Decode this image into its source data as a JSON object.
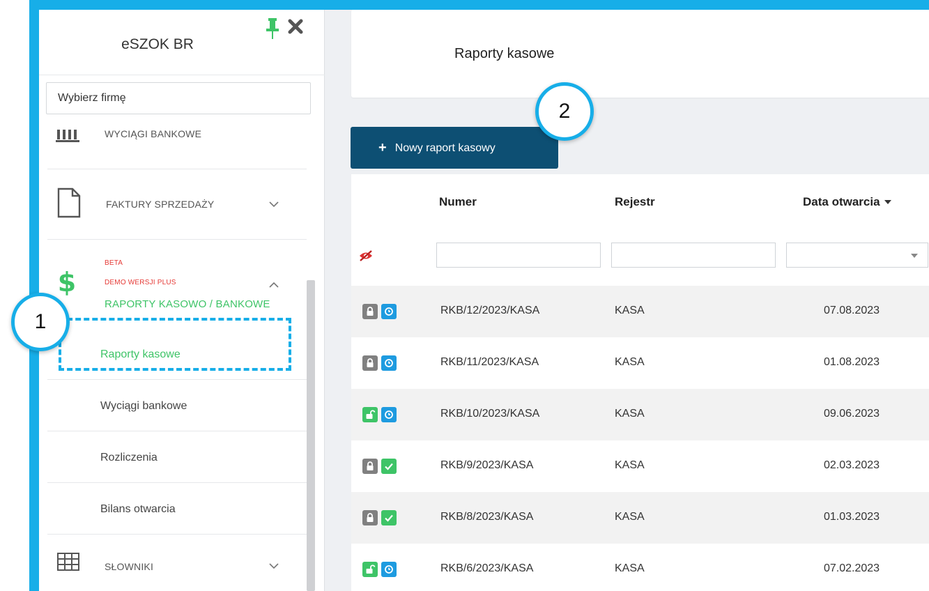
{
  "sidebar": {
    "app_title": "eSZOK BR",
    "firm_placeholder": "Wybierz firmę",
    "items": [
      {
        "label": "WYCIĄGI BANKOWE",
        "icon": "bank-icon"
      },
      {
        "label": "FAKTURY SPRZEDAŻY",
        "icon": "document-icon"
      },
      {
        "label": "RAPORTY KASOWO / BANKOWE",
        "icon": "dollar-icon",
        "tag1": "BETA",
        "tag2": "DEMO WERSJI PLUS"
      },
      {
        "label": "SŁOWNIKI",
        "icon": "grid-table-icon"
      }
    ],
    "sub_items": [
      "Raporty kasowe",
      "Wyciągi bankowe",
      "Rozliczenia",
      "Bilans otwarcia"
    ]
  },
  "main": {
    "page_title": "Raporty kasowe",
    "new_button_label": "Nowy raport kasowy",
    "columns": [
      "Numer",
      "Rejestr",
      "Data otwarcia"
    ],
    "rows": [
      {
        "lock": "locked",
        "status": "clock",
        "numer": "RKB/12/2023/KASA",
        "rejestr": "KASA",
        "data": "07.08.2023"
      },
      {
        "lock": "locked",
        "status": "clock",
        "numer": "RKB/11/2023/KASA",
        "rejestr": "KASA",
        "data": "01.08.2023"
      },
      {
        "lock": "unlocked",
        "status": "clock",
        "numer": "RKB/10/2023/KASA",
        "rejestr": "KASA",
        "data": "09.06.2023"
      },
      {
        "lock": "locked",
        "status": "check",
        "numer": "RKB/9/2023/KASA",
        "rejestr": "KASA",
        "data": "02.03.2023"
      },
      {
        "lock": "locked",
        "status": "check",
        "numer": "RKB/8/2023/KASA",
        "rejestr": "KASA",
        "data": "01.03.2023"
      },
      {
        "lock": "unlocked",
        "status": "clock",
        "numer": "RKB/6/2023/KASA",
        "rejestr": "KASA",
        "data": "07.02.2023"
      }
    ]
  },
  "annotations": {
    "callout_1": "1",
    "callout_2": "2"
  },
  "colors": {
    "accent": "#17aee8",
    "primary_button": "#0d4f73",
    "active_green": "#3ec467",
    "beta_red": "#e53935"
  }
}
